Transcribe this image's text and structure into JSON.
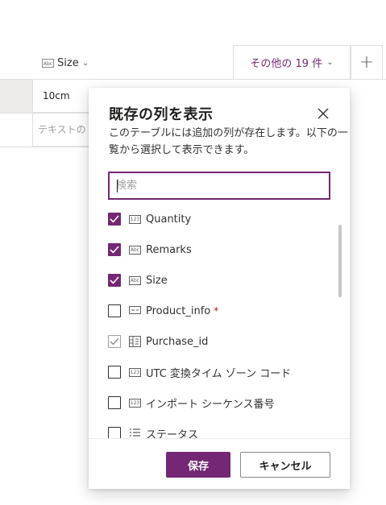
{
  "background": {
    "size_column_header": "Size",
    "size_column_type_icon": "text-type-icon",
    "more_columns_label": "その他の 19 件",
    "add_column_icon": "plus-icon",
    "row1_size": "10cm",
    "row2_size_placeholder": "テキストの"
  },
  "dialog": {
    "title": "既存の列を表示",
    "description": "このテーブルには追加の列が存在します。以下の一覧から選択して表示できます。",
    "search_placeholder": "検索",
    "columns": [
      {
        "label": "Quantity",
        "type_icon": "number-type-icon",
        "checked": true,
        "required": false
      },
      {
        "label": "Remarks",
        "type_icon": "text-type-icon",
        "checked": true,
        "required": false
      },
      {
        "label": "Size",
        "type_icon": "text-type-icon",
        "checked": true,
        "required": false
      },
      {
        "label": "Product_info",
        "type_icon": "lookup-type-icon",
        "checked": false,
        "required": true,
        "required_mark": "*"
      },
      {
        "label": "Purchase_id",
        "type_icon": "autonumber-type-icon",
        "checked": true,
        "disabled": true,
        "required": false
      },
      {
        "label": "UTC 変換タイム ゾーン コード",
        "type_icon": "number-type-icon",
        "checked": false,
        "required": false
      },
      {
        "label": "インポート シーケンス番号",
        "type_icon": "number-type-icon",
        "checked": false,
        "required": false
      },
      {
        "label": "ステータス",
        "type_icon": "choice-type-icon",
        "checked": false,
        "required": false
      }
    ],
    "save_label": "保存",
    "cancel_label": "キャンセル"
  }
}
